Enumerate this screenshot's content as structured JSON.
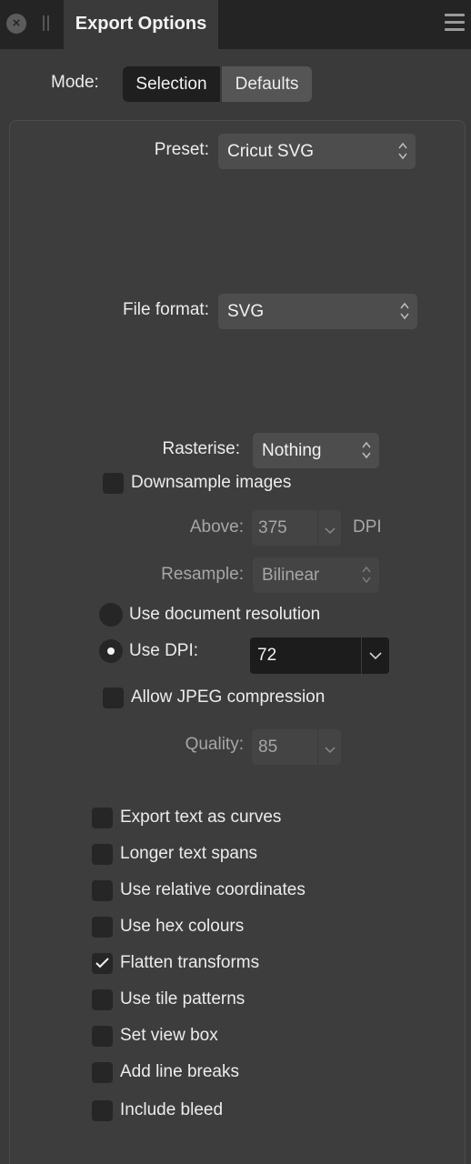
{
  "titlebar": {
    "close_icon": "close-circle-icon",
    "grip_icon": "panel-grip-icon",
    "tab_title": "Export Options",
    "menu_icon": "hamburger-menu-icon"
  },
  "mode": {
    "label": "Mode:",
    "options": [
      "Selection",
      "Defaults"
    ],
    "selected": "Selection"
  },
  "preset": {
    "label": "Preset:",
    "value": "Cricut SVG"
  },
  "file_format": {
    "label": "File format:",
    "value": "SVG"
  },
  "rasterise": {
    "label": "Rasterise:",
    "value": "Nothing"
  },
  "downsample": {
    "label": "Downsample images",
    "checked": false
  },
  "above": {
    "label": "Above:",
    "value": "375",
    "unit": "DPI"
  },
  "resample": {
    "label": "Resample:",
    "value": "Bilinear"
  },
  "resolution": {
    "use_document_label": "Use document resolution",
    "use_dpi_label": "Use DPI:",
    "selected": "Use DPI:",
    "dpi_value": "72"
  },
  "jpeg": {
    "label": "Allow JPEG compression",
    "checked": false
  },
  "quality": {
    "label": "Quality:",
    "value": "85"
  },
  "options": [
    {
      "label": "Export text as curves",
      "checked": false
    },
    {
      "label": "Longer text spans",
      "checked": false
    },
    {
      "label": "Use relative coordinates",
      "checked": false
    },
    {
      "label": "Use hex colours",
      "checked": false
    },
    {
      "label": "Flatten transforms",
      "checked": true
    },
    {
      "label": "Use tile patterns",
      "checked": false
    },
    {
      "label": "Set view box",
      "checked": false
    },
    {
      "label": "Add line breaks",
      "checked": false
    },
    {
      "label": "Include bleed",
      "checked": false
    }
  ],
  "colors": {
    "background": "#3a3a3a",
    "titlebar": "#242424",
    "control": "#4d4d4d",
    "control_dark": "#1f1f1f",
    "text": "#ececec",
    "text_dim": "#a6a6a6"
  }
}
